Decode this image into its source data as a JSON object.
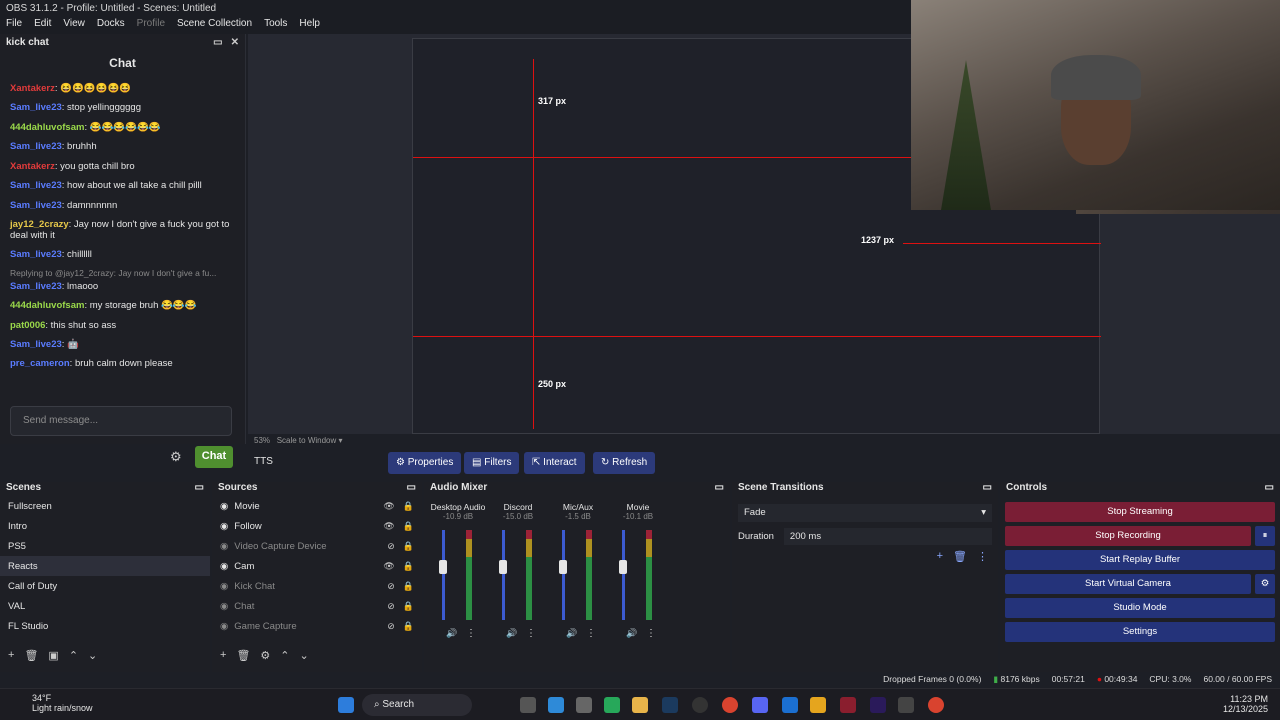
{
  "window": {
    "title": "OBS 31.1.2 - Profile: Untitled - Scenes: Untitled"
  },
  "menu": [
    "File",
    "Edit",
    "View",
    "Docks",
    "Profile",
    "Scene Collection",
    "Tools",
    "Help"
  ],
  "chat_dock": {
    "title": "kick chat",
    "heading": "Chat",
    "messages": [
      {
        "user": "Xantakerz",
        "text": "😆😆😆😆😆😆",
        "color": "#e23b3b"
      },
      {
        "user": "Sam_live23",
        "text": "stop yellingggggg",
        "color": "#5a7cff"
      },
      {
        "user": "444dahluvofsam",
        "text": "😂😂😂😂😂😂",
        "color": "#9ad94a"
      },
      {
        "user": "Sam_live23",
        "text": "bruhhh",
        "color": "#5a7cff"
      },
      {
        "user": "Xantakerz",
        "text": "you gotta chill bro",
        "color": "#e23b3b"
      },
      {
        "user": "Sam_live23",
        "text": "how about we all take a chill pilll",
        "color": "#5a7cff"
      },
      {
        "user": "Sam_live23",
        "text": "damnnnnnn",
        "color": "#5a7cff"
      },
      {
        "user": "jay12_2crazy",
        "text": "Jay now I don't give a fuck you got to deal with it",
        "color": "#e6c84a"
      },
      {
        "user": "Sam_live23",
        "text": "chillllll",
        "color": "#5a7cff"
      },
      {
        "user": "Sam_live23",
        "text": "lmaooo",
        "color": "#5a7cff",
        "reply": "Replying to @jay12_2crazy: Jay now I don't give a fu..."
      },
      {
        "user": "444dahluvofsam",
        "text": "my storage bruh 😂😂😂",
        "color": "#9ad94a"
      },
      {
        "user": "pat0006",
        "text": "this shut so ass",
        "color": "#9ad94a"
      },
      {
        "user": "Sam_live23",
        "text": "🤖",
        "color": "#5a7cff"
      },
      {
        "user": "pre_cameron",
        "text": "bruh calm down please",
        "color": "#5a7cff"
      }
    ],
    "placeholder": "Send message...",
    "send_label": "Chat"
  },
  "preview": {
    "zoom": "53%",
    "scale_mode": "Scale to Window",
    "nested_labels": [
      "317 px",
      "1237 px",
      "250 px"
    ]
  },
  "source_toolbar": {
    "source": "TTS",
    "buttons": [
      "Properties",
      "Filters",
      "Interact",
      "Refresh"
    ]
  },
  "scenes": {
    "title": "Scenes",
    "items": [
      "Fullscreen",
      "Intro",
      "PS5",
      "Reacts",
      "Call of Duty",
      "VAL",
      "FL Studio"
    ],
    "selected": "Reacts"
  },
  "sources": {
    "title": "Sources",
    "items": [
      {
        "name": "Movie",
        "visible": true
      },
      {
        "name": "Follow",
        "visible": true
      },
      {
        "name": "Video Capture Device",
        "visible": false
      },
      {
        "name": "Cam",
        "visible": true
      },
      {
        "name": "Kick Chat",
        "visible": false
      },
      {
        "name": "Chat",
        "visible": false
      },
      {
        "name": "Game Capture",
        "visible": false
      }
    ]
  },
  "audio_mixer": {
    "title": "Audio Mixer",
    "channels": [
      {
        "name": "Desktop Audio",
        "db": "-10.9 dB"
      },
      {
        "name": "Discord",
        "db": "-15.0 dB"
      },
      {
        "name": "Mic/Aux",
        "db": "-1.5 dB"
      },
      {
        "name": "Movie",
        "db": "-10.1 dB"
      }
    ]
  },
  "transitions": {
    "title": "Scene Transitions",
    "selected": "Fade",
    "duration_label": "Duration",
    "duration_value": "200 ms"
  },
  "controls": {
    "title": "Controls",
    "buttons": [
      "Stop Streaming",
      "Stop Recording",
      "Start Replay Buffer",
      "Start Virtual Camera",
      "Studio Mode",
      "Settings"
    ]
  },
  "status": {
    "dropped": "Dropped Frames 0 (0.0%)",
    "bitrate": "8176 kbps",
    "stream_time": "00:57:21",
    "rec_time": "00:49:34",
    "cpu": "CPU: 3.0%",
    "fps": "60.00 / 60.00 FPS"
  },
  "taskbar": {
    "weather_temp": "34°F",
    "weather_desc": "Light rain/snow",
    "search": "Search",
    "time": "11:23 PM",
    "date": "12/13/2025"
  }
}
